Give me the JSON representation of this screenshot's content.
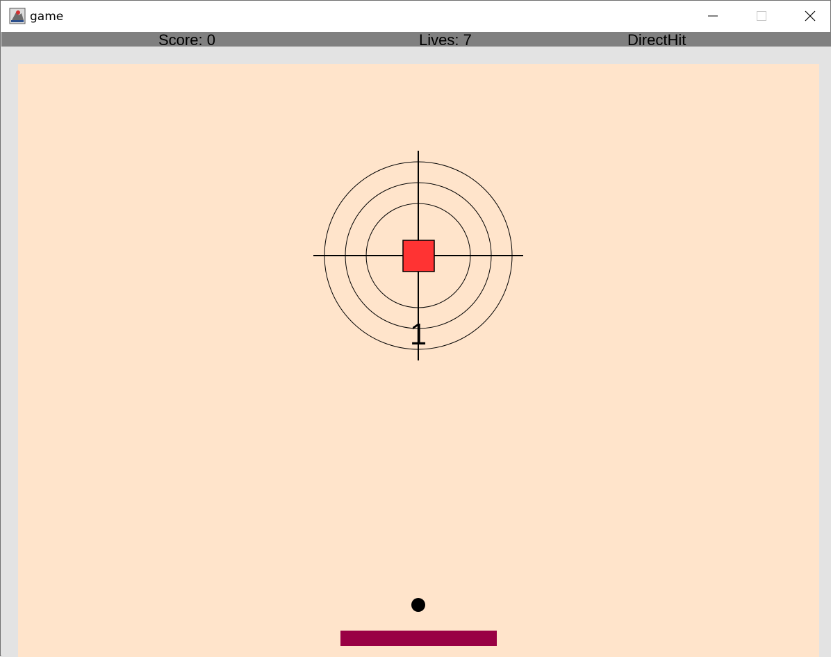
{
  "window": {
    "title": "game",
    "icon": "java-app-icon",
    "controls": [
      "minimize-icon",
      "maximize-icon",
      "close-icon"
    ]
  },
  "status": {
    "score_text": "Score: 0",
    "lives_text": "Lives: 7",
    "mode_text": "DirectHit"
  },
  "game": {
    "target_counter": "1",
    "colors": {
      "playfield": "#ffe4cb",
      "target_block": "#ff3333",
      "paddle": "#990044",
      "ball": "#000000",
      "statusbar": "#808080"
    }
  }
}
